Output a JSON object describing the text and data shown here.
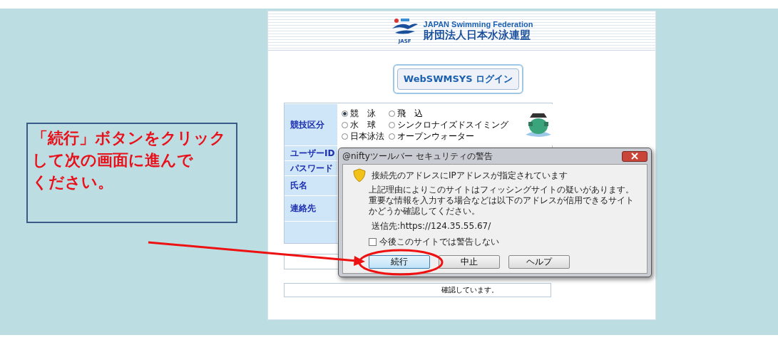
{
  "site": {
    "org_en": "JAPAN Swimming Federation",
    "org_ja": "財団法人日本水泳連盟",
    "logo_caption": "JASF"
  },
  "login_title": "WebSWMSYS ログイン",
  "form": {
    "category_label": "競技区分",
    "categories": [
      {
        "label": "競　泳",
        "selected": true
      },
      {
        "label": "飛　込",
        "selected": false
      },
      {
        "label": "水　球",
        "selected": false
      },
      {
        "label": "シンクロナイズドスイミング",
        "selected": false
      },
      {
        "label": "日本泳法",
        "selected": false
      },
      {
        "label": "オープンウォーター",
        "selected": false
      }
    ],
    "fields": [
      {
        "label": "ユーザーID"
      },
      {
        "label": "パスワード"
      },
      {
        "label": "氏名"
      },
      {
        "label": "連絡先"
      }
    ]
  },
  "note": "確認しています。",
  "dialog": {
    "title": "@niftyツールバー セキュリティの警告",
    "headline": "接続先のアドレスにIPアドレスが指定されています",
    "message": "上記理由によりこのサイトはフィッシングサイトの疑いがあります。重要な情報を入力する場合などは以下のアドレスが信用できるサイトかどうか確認してください。",
    "destination": "送信先:https://124.35.55.67/",
    "checkbox": {
      "label": "今後このサイトでは警告しない",
      "checked": false
    },
    "buttons": [
      {
        "label": "続行",
        "focused": true
      },
      {
        "label": "中止",
        "focused": false
      },
      {
        "label": "ヘルプ",
        "focused": false
      }
    ]
  },
  "annotation": {
    "lines": [
      "「続行」ボタンをクリック",
      "して次の画面に進んで",
      "ください。"
    ]
  }
}
